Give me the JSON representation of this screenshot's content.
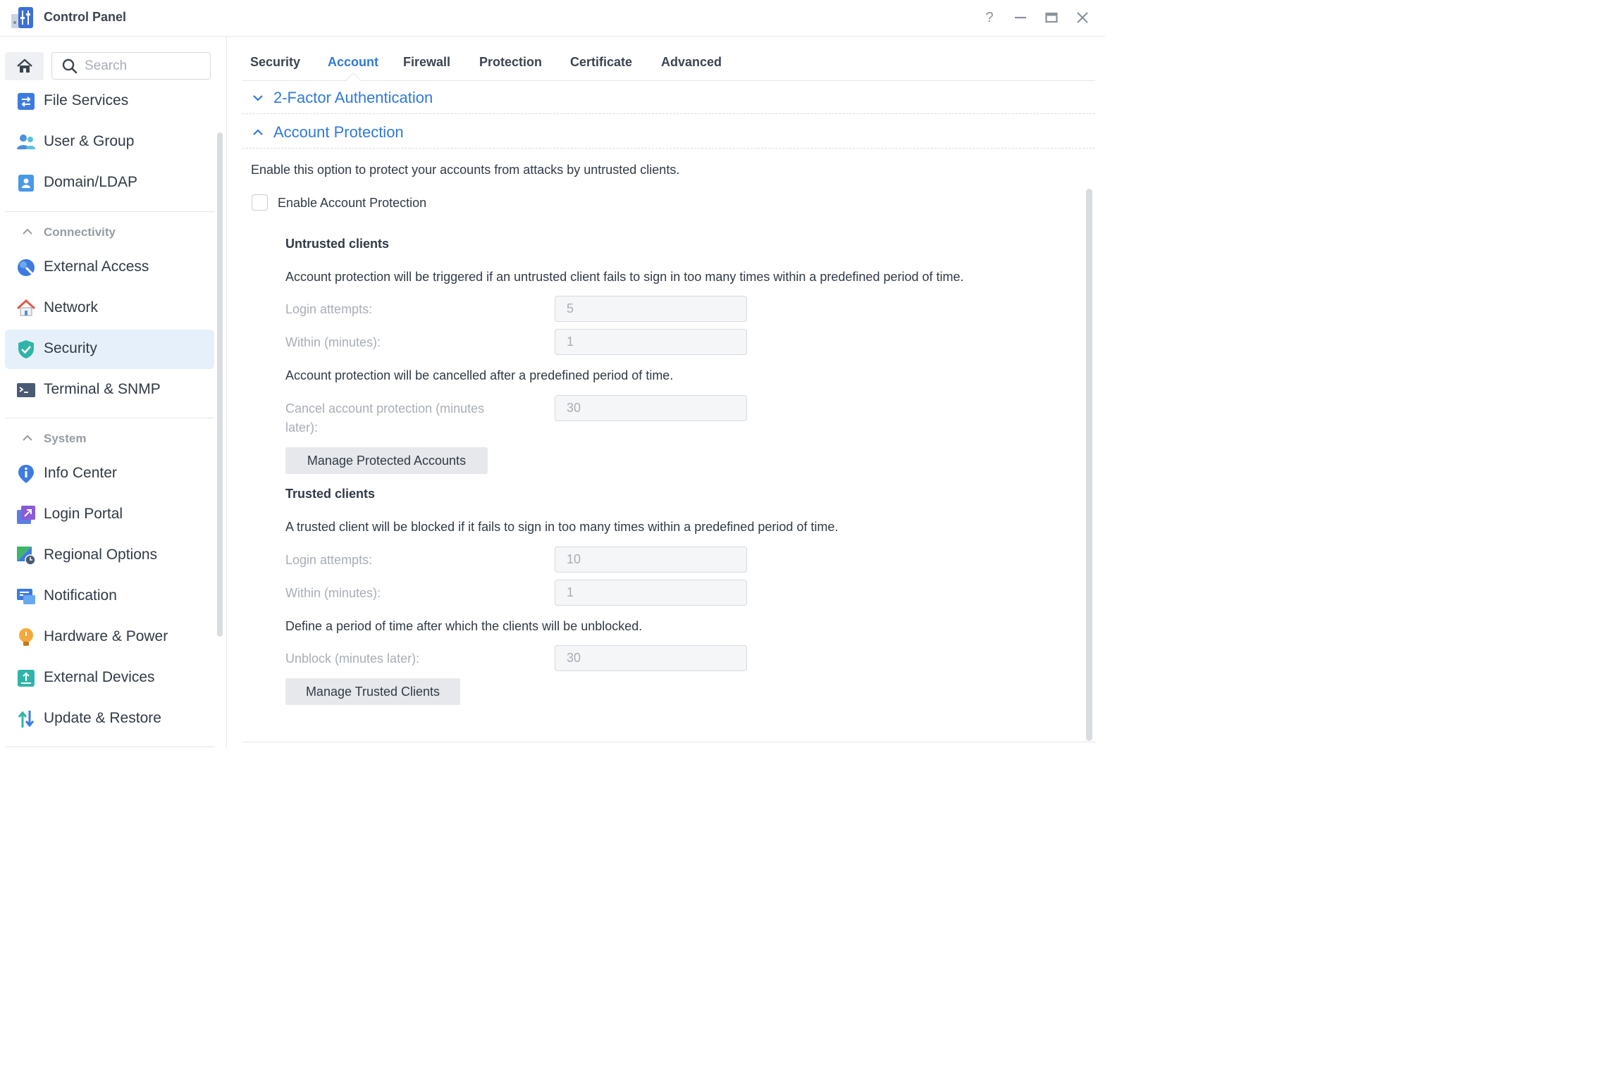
{
  "window": {
    "title": "Control Panel",
    "app_icon": "control-panel-icon",
    "controls": {
      "help": "?",
      "minimize": "–",
      "maximize": "□",
      "close": "✕"
    }
  },
  "sidebar": {
    "search_placeholder": "Search",
    "items_top": [
      {
        "label": "File Services",
        "icon": "file-services-icon"
      },
      {
        "label": "User & Group",
        "icon": "user-group-icon"
      },
      {
        "label": "Domain/LDAP",
        "icon": "domain-ldap-icon"
      }
    ],
    "group_connectivity": "Connectivity",
    "items_connectivity": [
      {
        "label": "External Access",
        "icon": "external-access-icon"
      },
      {
        "label": "Network",
        "icon": "network-icon"
      },
      {
        "label": "Security",
        "icon": "security-shield-icon",
        "active": true
      },
      {
        "label": "Terminal & SNMP",
        "icon": "terminal-icon"
      }
    ],
    "group_system": "System",
    "items_system": [
      {
        "label": "Info Center",
        "icon": "info-icon"
      },
      {
        "label": "Login Portal",
        "icon": "login-portal-icon"
      },
      {
        "label": "Regional Options",
        "icon": "regional-options-icon"
      },
      {
        "label": "Notification",
        "icon": "notification-icon"
      },
      {
        "label": "Hardware & Power",
        "icon": "hardware-power-icon"
      },
      {
        "label": "External Devices",
        "icon": "external-devices-icon"
      },
      {
        "label": "Update & Restore",
        "icon": "update-restore-icon"
      }
    ]
  },
  "tabs": [
    "Security",
    "Account",
    "Firewall",
    "Protection",
    "Certificate",
    "Advanced"
  ],
  "active_tab": "Account",
  "sections": {
    "two_factor": "2-Factor Authentication",
    "account_protection": "Account Protection"
  },
  "content": {
    "intro": "Enable this option to protect your accounts from attacks by untrusted clients.",
    "enable_label": "Enable Account Protection",
    "enable_checked": false,
    "untrusted": {
      "heading": "Untrusted clients",
      "desc": "Account protection will be triggered if an untrusted client fails to sign in too many times within a predefined period of time.",
      "login_attempts_label": "Login attempts:",
      "login_attempts_value": "5",
      "within_label": "Within (minutes):",
      "within_value": "1",
      "cancel_desc": "Account protection will be cancelled after a predefined period of time.",
      "cancel_label_1": "Cancel account protection (minutes",
      "cancel_label_2": "later):",
      "cancel_value": "30",
      "manage_button": "Manage Protected Accounts"
    },
    "trusted": {
      "heading": "Trusted clients",
      "desc": "A trusted client will be blocked if it fails to sign in too many times within a predefined period of time.",
      "login_attempts_label": "Login attempts:",
      "login_attempts_value": "10",
      "within_label": "Within (minutes):",
      "within_value": "1",
      "unblock_desc": "Define a period of time after which the clients will be unblocked.",
      "unblock_label": "Unblock (minutes later):",
      "unblock_value": "30",
      "manage_button": "Manage Trusted Clients"
    }
  },
  "colors": {
    "accent": "#2f7ad8",
    "active_nav_bg": "#e6f0fa",
    "disabled_text": "#a8aeb6",
    "button_bg": "#e6e8eb"
  }
}
